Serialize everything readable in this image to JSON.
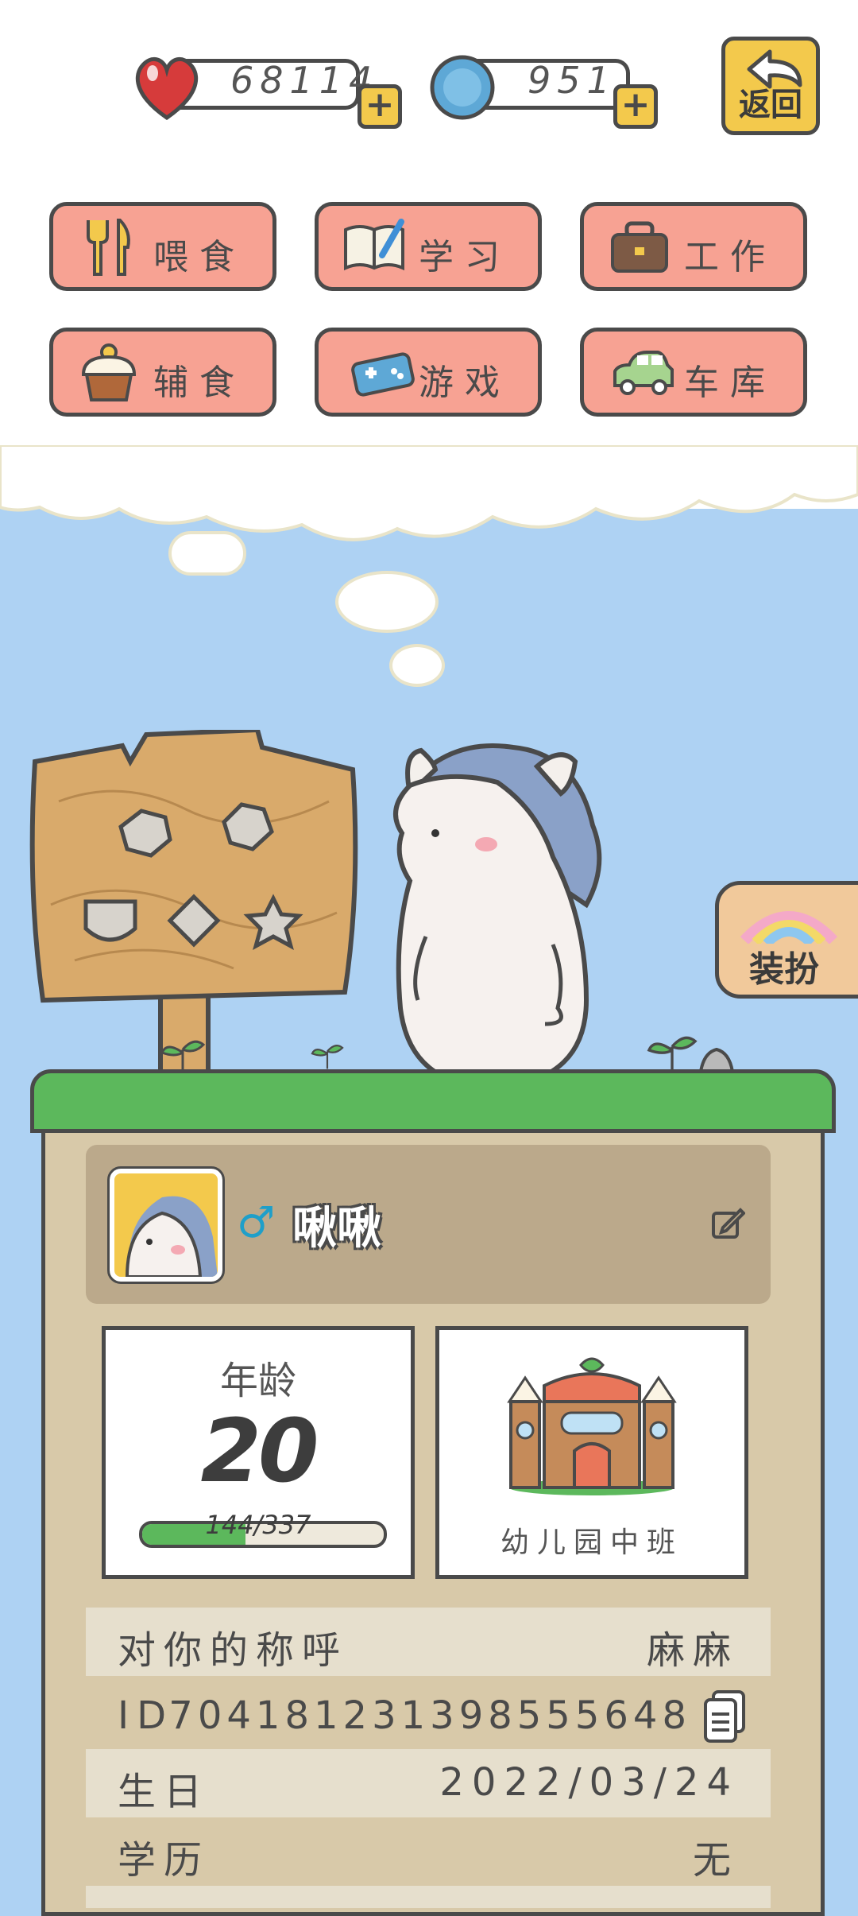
{
  "stats": {
    "hearts": "68114",
    "coins": "951"
  },
  "header": {
    "back_label": "返回"
  },
  "menu": [
    {
      "label": "喂食",
      "icon": "fork-knife-icon"
    },
    {
      "label": "学习",
      "icon": "book-pen-icon"
    },
    {
      "label": "工作",
      "icon": "briefcase-icon"
    },
    {
      "label": "辅食",
      "icon": "cupcake-icon"
    },
    {
      "label": "游戏",
      "icon": "gamepad-icon"
    },
    {
      "label": "车库",
      "icon": "car-icon"
    }
  ],
  "side": {
    "dress_label": "装扮"
  },
  "profile": {
    "name": "啾啾",
    "gender_symbol": "♂"
  },
  "age": {
    "title": "年龄",
    "value": "20",
    "progress_text": "144/337",
    "progress_fraction": 0.427
  },
  "school": {
    "label": "幼儿园中班"
  },
  "info": {
    "nickname_label": "对你的称呼",
    "nickname_value": "麻麻",
    "id_label": "ID",
    "id_value": "704181231398555648",
    "birthday_label": "生日",
    "birthday_value": "2022/03/24",
    "education_label": "学历",
    "education_value": "无"
  },
  "colors": {
    "sky": "#aed2f3",
    "button": "#f7a293",
    "accent_yellow": "#f3c94c",
    "grass": "#5cb85c",
    "panel": "#d8c9a9"
  }
}
